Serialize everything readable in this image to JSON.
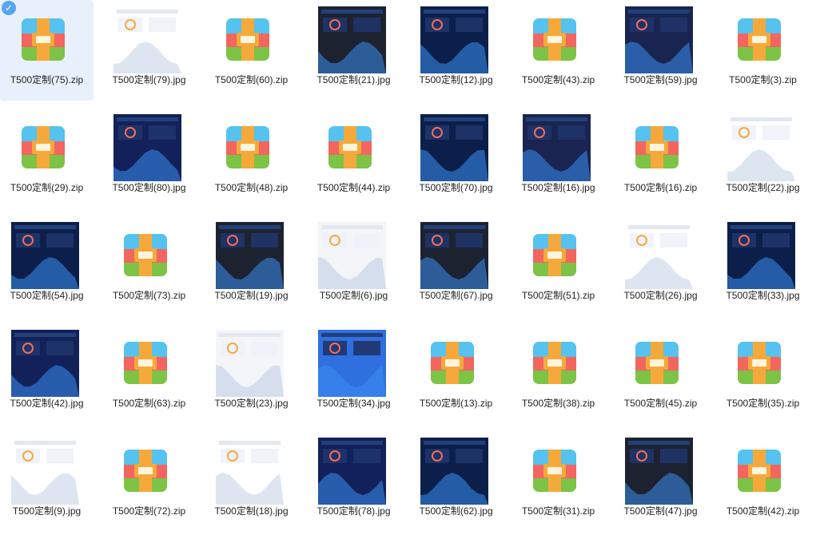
{
  "files": [
    {
      "name": "T500定制(75).zip",
      "type": "zip",
      "selected": true
    },
    {
      "name": "T500定制(79).jpg",
      "type": "jpg",
      "theme": "white"
    },
    {
      "name": "T500定制(60).zip",
      "type": "zip"
    },
    {
      "name": "T500定制(21).jpg",
      "type": "jpg",
      "theme": "dark1"
    },
    {
      "name": "T500定制(12).jpg",
      "type": "jpg",
      "theme": "dark2"
    },
    {
      "name": "T500定制(43).zip",
      "type": "zip"
    },
    {
      "name": "T500定制(59).jpg",
      "type": "jpg",
      "theme": "dark3"
    },
    {
      "name": "T500定制(3).zip",
      "type": "zip"
    },
    {
      "name": "T500定制(29).zip",
      "type": "zip"
    },
    {
      "name": "T500定制(80).jpg",
      "type": "jpg",
      "theme": "navy"
    },
    {
      "name": "T500定制(48).zip",
      "type": "zip"
    },
    {
      "name": "T500定制(44).zip",
      "type": "zip"
    },
    {
      "name": "T500定制(70).jpg",
      "type": "jpg",
      "theme": "dark2"
    },
    {
      "name": "T500定制(16).jpg",
      "type": "jpg",
      "theme": "dark3"
    },
    {
      "name": "T500定制(16).zip",
      "type": "zip"
    },
    {
      "name": "T500定制(22).jpg",
      "type": "jpg",
      "theme": "white"
    },
    {
      "name": "T500定制(54).jpg",
      "type": "jpg",
      "theme": "dark2"
    },
    {
      "name": "T500定制(73).zip",
      "type": "zip"
    },
    {
      "name": "T500定制(19).jpg",
      "type": "jpg",
      "theme": "dark1"
    },
    {
      "name": "T500定制(6).jpg",
      "type": "jpg",
      "theme": "light"
    },
    {
      "name": "T500定制(67).jpg",
      "type": "jpg",
      "theme": "dark1"
    },
    {
      "name": "T500定制(51).zip",
      "type": "zip"
    },
    {
      "name": "T500定制(26).jpg",
      "type": "jpg",
      "theme": "white"
    },
    {
      "name": "T500定制(33).jpg",
      "type": "jpg",
      "theme": "dark2"
    },
    {
      "name": "T500定制(42).jpg",
      "type": "jpg",
      "theme": "navy"
    },
    {
      "name": "T500定制(63).zip",
      "type": "zip"
    },
    {
      "name": "T500定制(23).jpg",
      "type": "jpg",
      "theme": "light"
    },
    {
      "name": "T500定制(34).jpg",
      "type": "jpg",
      "theme": "blue"
    },
    {
      "name": "T500定制(13).zip",
      "type": "zip"
    },
    {
      "name": "T500定制(38).zip",
      "type": "zip"
    },
    {
      "name": "T500定制(45).zip",
      "type": "zip"
    },
    {
      "name": "T500定制(35).zip",
      "type": "zip"
    },
    {
      "name": "T500定制(9).jpg",
      "type": "jpg",
      "theme": "white"
    },
    {
      "name": "T500定制(72).zip",
      "type": "zip"
    },
    {
      "name": "T500定制(18).jpg",
      "type": "jpg",
      "theme": "white"
    },
    {
      "name": "T500定制(78).jpg",
      "type": "jpg",
      "theme": "navy"
    },
    {
      "name": "T500定制(62).jpg",
      "type": "jpg",
      "theme": "dark2"
    },
    {
      "name": "T500定制(31).zip",
      "type": "zip"
    },
    {
      "name": "T500定制(47).jpg",
      "type": "jpg",
      "theme": "dark1"
    },
    {
      "name": "T500定制(42).zip",
      "type": "zip"
    }
  ]
}
